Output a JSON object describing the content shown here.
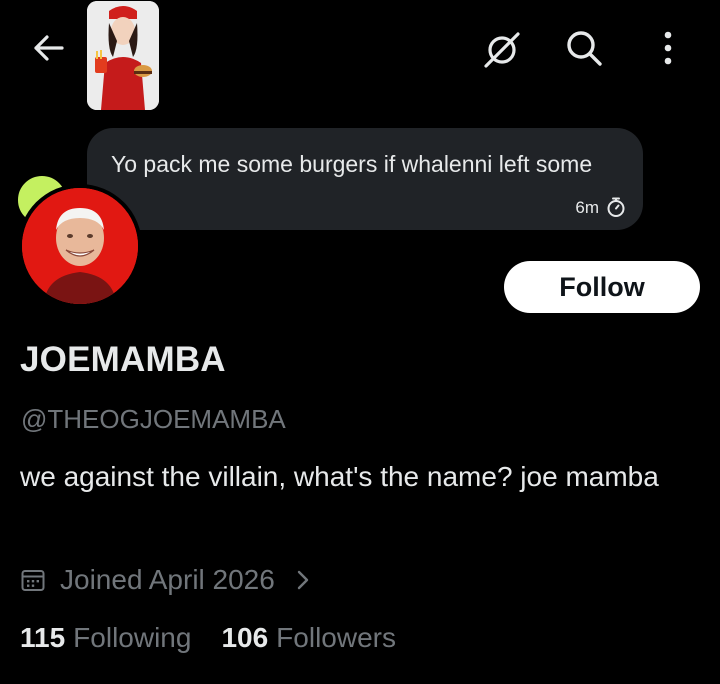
{
  "header": {
    "back_icon": "arrow-left-icon",
    "story_thumbnail": "story-thumbnail",
    "actions": [
      "no-grok-icon",
      "search-icon",
      "more-vertical-icon"
    ]
  },
  "note_bubble": {
    "text": "Yo pack me some burgers if whalenni left some",
    "time": "6m",
    "timer_icon": "stopwatch-icon"
  },
  "profile": {
    "display_name": "JOEMAMBA",
    "handle": "@THEOGJOEMAMBA",
    "bio": "we against the villain, what's the name? joe mamba",
    "joined": "Joined April 2026",
    "follow_label": "Follow",
    "following_count": "115",
    "following_label": "Following",
    "followers_count": "106",
    "followers_label": "Followers"
  },
  "colors": {
    "background": "#000000",
    "bubble": "#202327",
    "muted": "#71767b",
    "avatar_bg": "#e11812",
    "status_dot": "#c4f060"
  }
}
